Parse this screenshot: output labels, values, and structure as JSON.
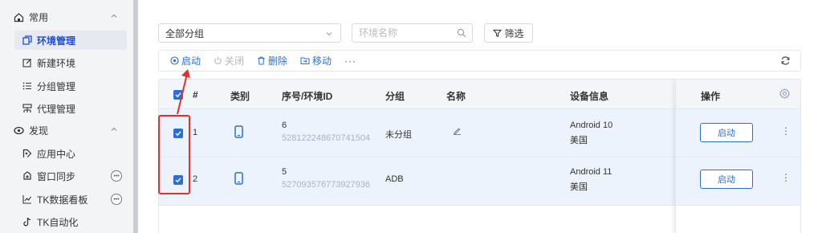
{
  "sidebar": {
    "sections": [
      {
        "label": "常用",
        "icon": "home-icon"
      },
      {
        "label": "发现",
        "icon": "compass-icon"
      }
    ],
    "items": [
      {
        "label": "环境管理",
        "icon": "env-icon",
        "active": true
      },
      {
        "label": "新建环境",
        "icon": "edit-icon"
      },
      {
        "label": "分组管理",
        "icon": "list-icon"
      },
      {
        "label": "代理管理",
        "icon": "proxy-icon"
      },
      {
        "label": "应用中心",
        "icon": "app-icon"
      },
      {
        "label": "窗口同步",
        "icon": "sync-icon",
        "badge": "•••"
      },
      {
        "label": "TK数据看板",
        "icon": "chart-icon",
        "badge": "•••"
      },
      {
        "label": "TK自动化",
        "icon": "tiktok-icon"
      }
    ]
  },
  "toolbar": {
    "group_select": "全部分组",
    "search_placeholder": "环境名称",
    "filter_label": "筛选"
  },
  "actions": {
    "start": "启动",
    "close": "关闭",
    "delete": "删除",
    "move": "移动",
    "more": "···"
  },
  "table": {
    "headers": {
      "num": "#",
      "type": "类别",
      "id": "序号/环境ID",
      "group": "分组",
      "name": "名称",
      "device": "设备信息",
      "ops": "操作"
    },
    "rows": [
      {
        "num": "1",
        "seq": "6",
        "env_id": "528122248670741504",
        "group": "未分组",
        "os": "Android 10",
        "region": "美国",
        "action": "启动",
        "checked": true
      },
      {
        "num": "2",
        "seq": "5",
        "env_id": "527093576773927936",
        "group": "ADB",
        "os": "Android 11",
        "region": "美国",
        "action": "启动",
        "checked": true
      }
    ]
  },
  "colors": {
    "accent": "#2b6fd6",
    "highlight": "#e03131"
  }
}
